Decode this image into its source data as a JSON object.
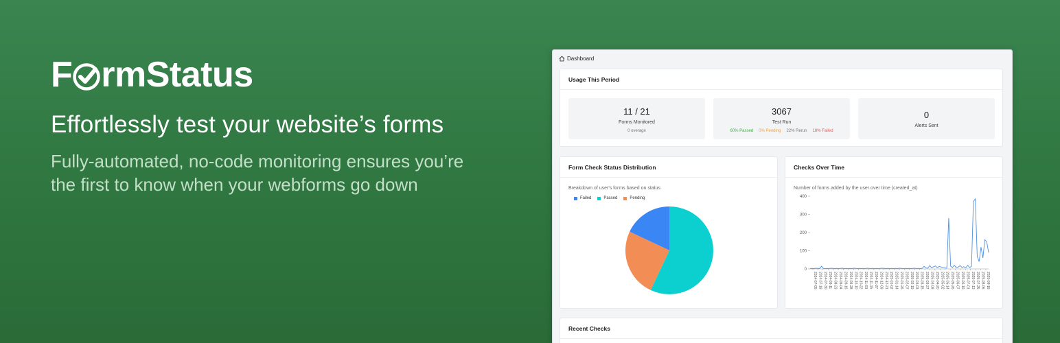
{
  "brand": {
    "logo_pre": "F",
    "logo_post": "rmStatus",
    "title": "Effortlessly test your website’s forms",
    "subtitle": "Fully-automated, no-code monitoring ensures you’re the first to know when your webforms go down",
    "logo_icon": "check-badge-icon"
  },
  "dashboard": {
    "breadcrumb": "Dashboard",
    "usage": {
      "title": "Usage This Period",
      "forms": {
        "value": "11 / 21",
        "label": "Forms Monitored",
        "note": "0 overage"
      },
      "tests": {
        "value": "3067",
        "label": "Test Run",
        "passed": "60% Passed",
        "pending": "0% Pending",
        "rerun": "22% Rerun",
        "failed": "18% Failed"
      },
      "alerts": {
        "value": "0",
        "label": "Alerts Sent"
      }
    },
    "pie": {
      "title": "Form Check Status Distribution",
      "description": "Breakdown of user's forms based on status",
      "legend": [
        "Failed",
        "Passed",
        "Pending"
      ]
    },
    "line": {
      "title": "Checks Over Time",
      "description": "Number of forms added by the user over time (created_at)"
    },
    "recent": {
      "title": "Recent Checks"
    }
  },
  "colors": {
    "failed": "#3b86f5",
    "passed": "#0ccfcf",
    "pending": "#f28d56",
    "line": "#4a90e2",
    "green_bg": "#2f7640"
  },
  "chart_data": [
    {
      "type": "pie",
      "title": "Form Check Status Distribution",
      "categories": [
        "Failed",
        "Passed",
        "Pending"
      ],
      "values": [
        18,
        57,
        25
      ],
      "colors": [
        "#3b86f5",
        "#0ccfcf",
        "#f28d56"
      ],
      "legend": "top-left"
    },
    {
      "type": "line",
      "title": "Checks Over Time",
      "ylim": [
        0,
        400
      ],
      "yticks": [
        0,
        100,
        200,
        300,
        400
      ],
      "xticks": [
        "2024-07-05",
        "2024-07-18",
        "2024-07-30",
        "2024-08-11",
        "2024-08-23",
        "2024-09-04",
        "2024-09-16",
        "2024-09-28",
        "2024-10-10",
        "2024-10-22",
        "2024-11-03",
        "2024-11-15",
        "2024-11-27",
        "2024-12-09",
        "2024-12-21",
        "2025-01-02",
        "2025-01-14",
        "2025-01-26",
        "2025-02-07",
        "2025-02-19",
        "2025-03-03",
        "2025-03-15",
        "2025-03-27",
        "2025-04-08",
        "2025-04-20",
        "2025-05-02",
        "2025-05-14",
        "2025-05-26",
        "2025-06-07",
        "2025-06-19",
        "2025-07-01",
        "2025-07-13",
        "2025-07-25",
        "2025-08-06",
        "2025-08-18"
      ],
      "series": [
        {
          "values": [
            2,
            3,
            2,
            4,
            3,
            2,
            15,
            3,
            2,
            3,
            2,
            4,
            3,
            2,
            3,
            2,
            3,
            4,
            2,
            3,
            2,
            3,
            2,
            4,
            3,
            2,
            3,
            2,
            3,
            2,
            4,
            3,
            2,
            3,
            2,
            3,
            2,
            3,
            4,
            3,
            2,
            3,
            2,
            3,
            2,
            3,
            2,
            4,
            3,
            2,
            3,
            2,
            3,
            2,
            3,
            4,
            2,
            3,
            2,
            3,
            14,
            5,
            4,
            18,
            6,
            12,
            16,
            6,
            14,
            10,
            8,
            5,
            4,
            280,
            15,
            8,
            20,
            6,
            10,
            18,
            8,
            12,
            6,
            20,
            8,
            14,
            370,
            385,
            70,
            40,
            120,
            60,
            160,
            150,
            90
          ]
        }
      ]
    }
  ]
}
